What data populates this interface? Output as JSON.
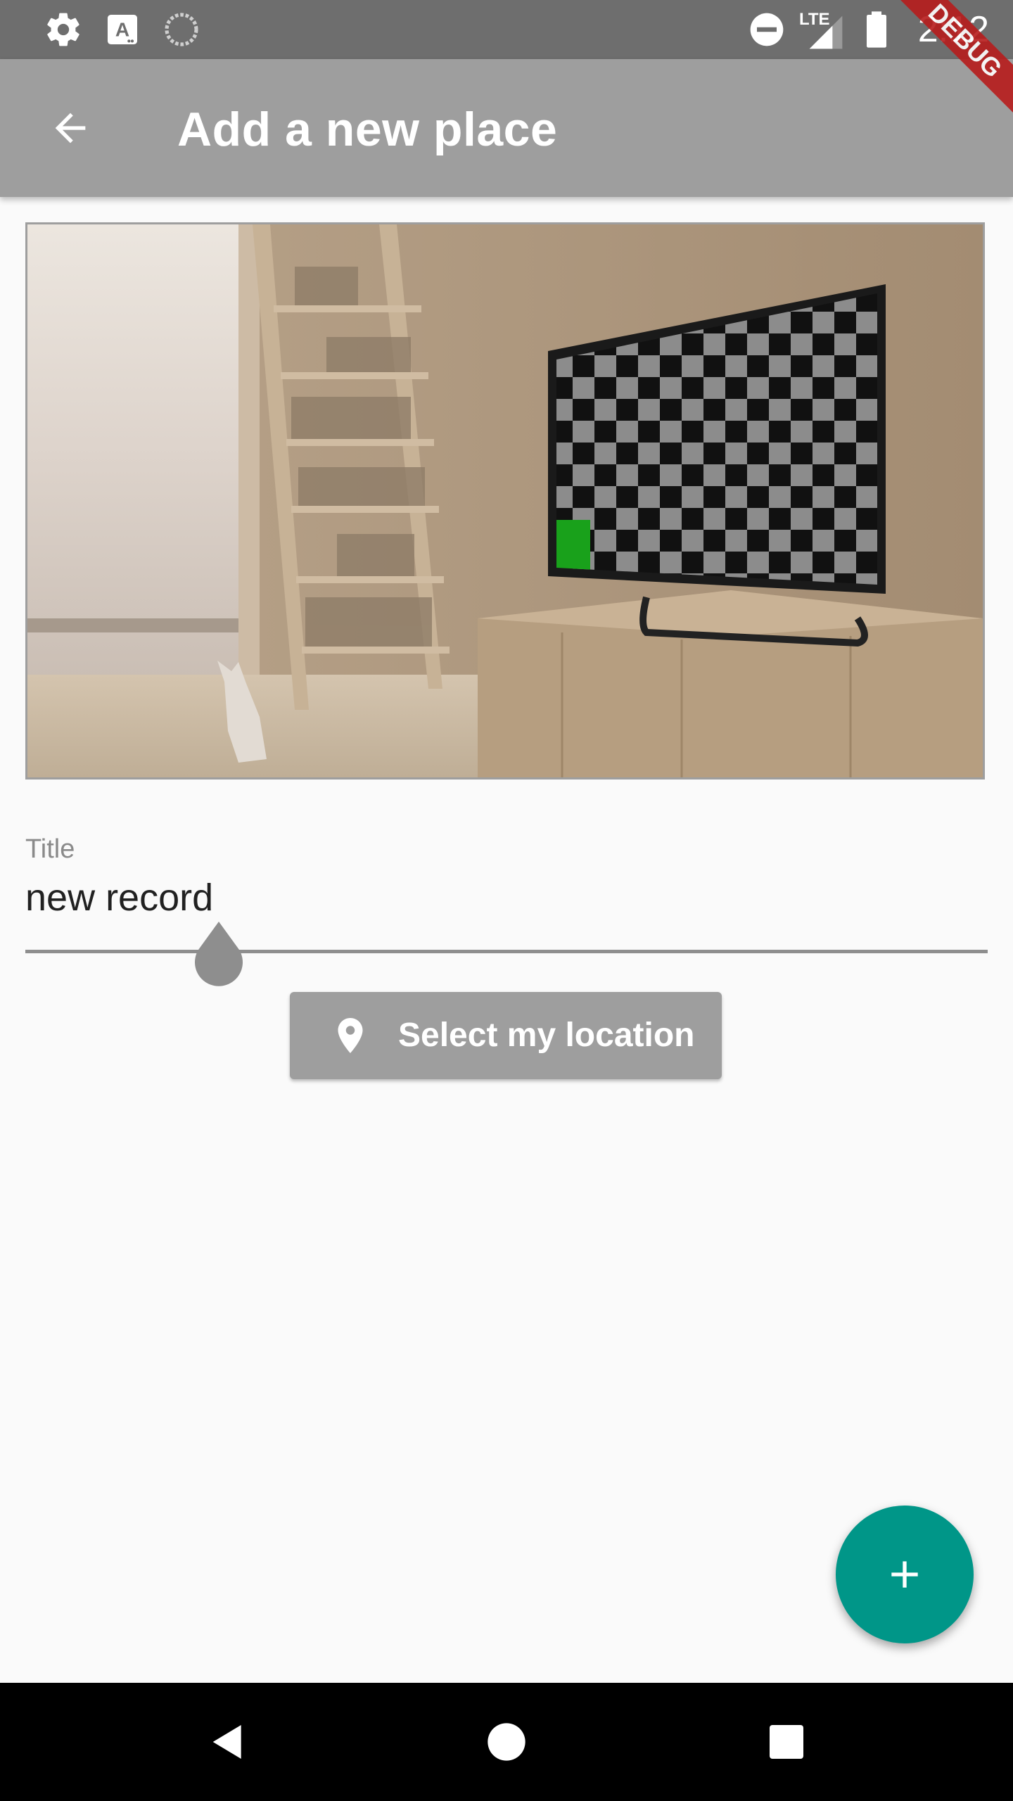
{
  "status_bar": {
    "time": "2:12",
    "network_label": "LTE",
    "icons": [
      "settings-icon",
      "accessibility-a-icon",
      "sync-icon",
      "do-not-disturb-icon",
      "signal-icon",
      "battery-icon"
    ]
  },
  "debug_banner": {
    "label": "DEBUG"
  },
  "app_bar": {
    "title": "Add a new place",
    "back_icon": "arrow-back-icon"
  },
  "image_preview": {
    "description_icon": "room-photo"
  },
  "title_field": {
    "label": "Title",
    "value": "new record"
  },
  "location_button": {
    "label": "Select my location",
    "icon": "location-pin-icon"
  },
  "fab": {
    "icon": "add-icon"
  },
  "nav_bar": {
    "icons": [
      "back-triangle-icon",
      "home-circle-icon",
      "recents-square-icon"
    ]
  },
  "colors": {
    "status_bar": "#6e6e6e",
    "app_bar": "#9e9e9e",
    "background": "#fafafa",
    "fab": "#009688",
    "debug": "#b71c1c"
  }
}
